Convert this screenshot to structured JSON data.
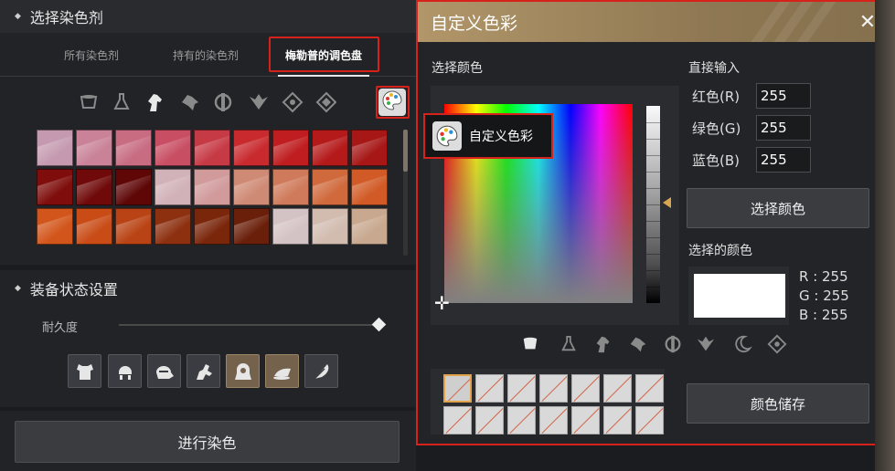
{
  "left": {
    "section_dye": "选择染色剂",
    "tabs": [
      "所有染色剂",
      "持有的染色剂",
      "梅勒普的调色盘"
    ],
    "category_icons": [
      "bucket-icon",
      "flask-icon",
      "horse-icon",
      "wolf-icon",
      "cog-icon",
      "bird-icon",
      "target-icon",
      "star-icon"
    ],
    "palette_icon": "palette-icon",
    "swatch_colors": [
      [
        "#c59ab0",
        "#c98298",
        "#c86c82",
        "#c84e63",
        "#c63a45",
        "#c82a2e",
        "#bf1d1f",
        "#b51a1b",
        "#a61716"
      ],
      [
        "#7e0d0b",
        "#700a0a",
        "#5f0707",
        "#d1b2b8",
        "#d19a9b",
        "#cf8a75",
        "#cf7a5a",
        "#d06a3d",
        "#d15a26"
      ],
      [
        "#d2561b",
        "#c94c17",
        "#b94314",
        "#8d3010",
        "#7a260b",
        "#6a1f0a",
        "#d4c3c4",
        "#d2bcb0",
        "#c8a88e"
      ]
    ],
    "section_equip": "装备状态设置",
    "durability_label": "耐久度",
    "durability_value": 1.0,
    "equip_icons": [
      "armor-icon",
      "helmet-icon",
      "knight-helmet-icon",
      "rider-icon",
      "hooded-icon",
      "horse-gear-icon",
      "feather-icon"
    ],
    "dye_button": "进行染色"
  },
  "dialog": {
    "title": "自定义色彩",
    "pick_label": "选择颜色",
    "direct_label": "直接输入",
    "red_label": "红色(R)",
    "green_label": "绿色(G)",
    "blue_label": "蓝色(B)",
    "red_value": "255",
    "green_value": "255",
    "blue_value": "255",
    "select_btn": "选择颜色",
    "selected_label": "选择的颜色",
    "selected_color": "#ffffff",
    "r_text": "R : 255",
    "g_text": "G : 255",
    "b_text": "B : 255",
    "tooltip": "自定义色彩",
    "category_icons": [
      "bucket-icon",
      "flask-icon",
      "horse-icon",
      "wolf-icon",
      "cog-icon",
      "bird-icon",
      "moon-icon",
      "target-icon"
    ],
    "save_btn": "颜色储存"
  },
  "colors": {
    "highlight_border": "#d7221c",
    "title_bar": "#a48a60"
  }
}
